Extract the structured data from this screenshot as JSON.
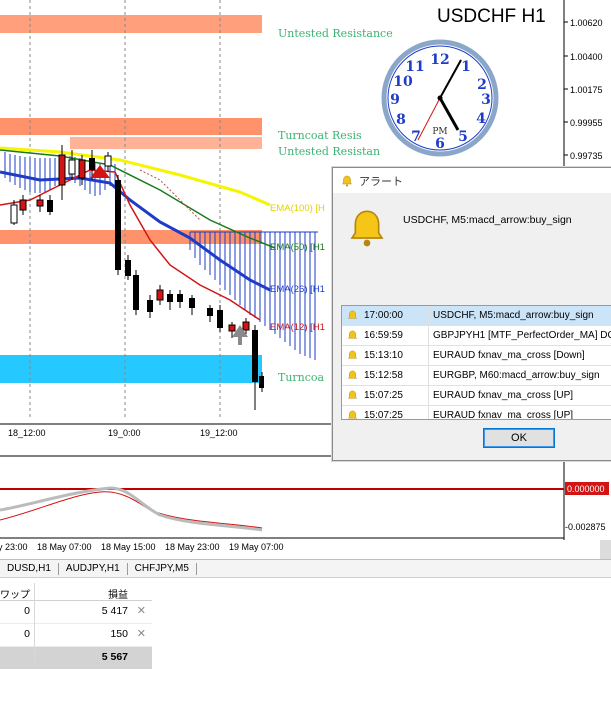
{
  "chart": {
    "symbol_title": "USDCHF H1",
    "price_axis": [
      "1.00620",
      "1.00400",
      "1.00175",
      "0.99955",
      "0.99735"
    ],
    "indicator_axis": [
      "0.000000",
      "-0.002875"
    ],
    "time_axis_main": [
      "18_12:00",
      "19_0:00",
      "19_12:00"
    ],
    "time_axis_bottom": [
      "y 23:00",
      "18 May 07:00",
      "18 May 15:00",
      "18 May 23:00",
      "19 May 07:00"
    ],
    "zone_labels": {
      "untested_top": "Untested Resistance",
      "turncoat_1": "Turncoat Resis",
      "untested_2": "Untested Resistan",
      "turncoat_low": "Turncoa"
    },
    "ma_labels": {
      "ema100": "EMA(100) [H",
      "ema50": "EMA(50) [H1",
      "ema26": "EMA(26) [H1",
      "ema12": "EMA(12) [H1"
    },
    "clock_pm": "PM",
    "colors": {
      "zone_red": "#ff7f50",
      "zone_blue": "#00bfff",
      "ema100": "#f5f500",
      "ema50": "#1a7a1a",
      "ema26": "#1e3cc8",
      "ema12": "#d21414",
      "label_green": "#3cb371"
    }
  },
  "alert": {
    "title": "アラート",
    "message": "USDCHF, M5:macd_arrow:buy_sign",
    "rows": [
      {
        "time": "17:00:00",
        "text": "USDCHF, M5:macd_arrow:buy_sign"
      },
      {
        "time": "16:59:59",
        "text": "GBPJPYH1 [MTF_PerfectOrder_MA] DO"
      },
      {
        "time": "15:13:10",
        "text": "EURAUD fxnav_ma_cross [Down]"
      },
      {
        "time": "15:12:58",
        "text": "EURGBP, M60:macd_arrow:buy_sign"
      },
      {
        "time": "15:07:25",
        "text": "EURAUD fxnav_ma_cross [UP]"
      },
      {
        "time": "15:07:25",
        "text": "EURAUD fxnav_ma_cross [UP]"
      }
    ],
    "ok_label": "OK",
    "bell_icon": "bell-icon"
  },
  "tabs": [
    "DUSD,H1",
    "AUDJPY,H1",
    "CHFJPY,M5"
  ],
  "terminal": {
    "col_swap": "ワップ",
    "col_profit": "損益",
    "rows": [
      {
        "swap": "0",
        "profit": "5 417"
      },
      {
        "swap": "0",
        "profit": "150"
      }
    ],
    "total": "5 567"
  }
}
